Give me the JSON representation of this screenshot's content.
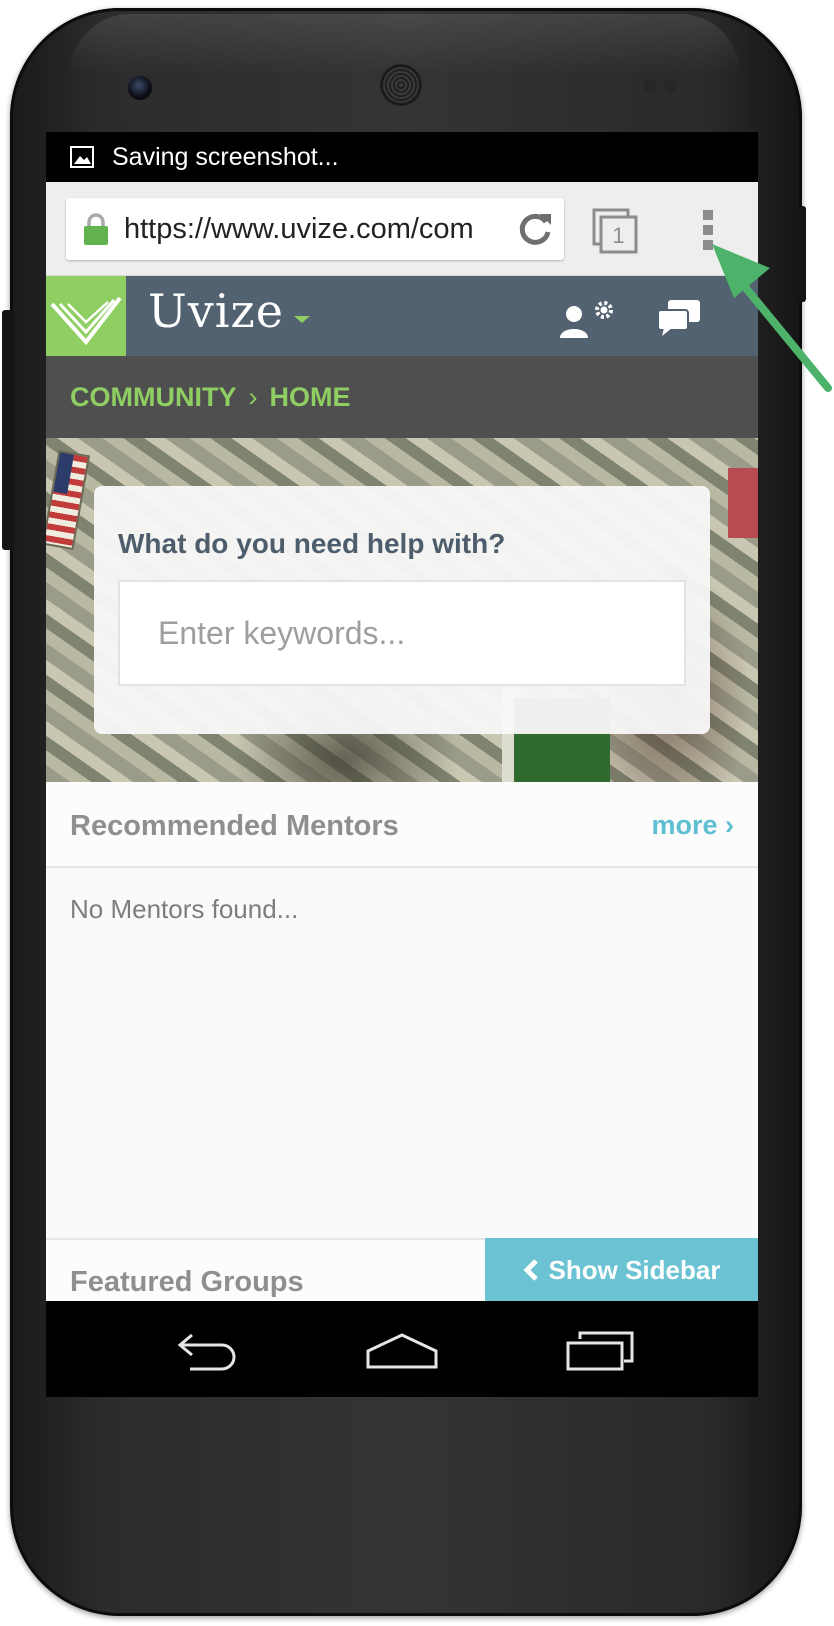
{
  "status_bar": {
    "notification_text": "Saving screenshot..."
  },
  "browser": {
    "url": "https://www.uvize.com/com",
    "tab_count": "1"
  },
  "site_header": {
    "brand_name": "Uvize"
  },
  "breadcrumb": {
    "items": [
      "COMMUNITY",
      "HOME"
    ],
    "separator": "›"
  },
  "hero_search": {
    "question": "What do you need help with?",
    "placeholder": "Enter keywords..."
  },
  "mentors_section": {
    "title": "Recommended Mentors",
    "more_label": "more ›",
    "empty_message": "No Mentors found..."
  },
  "groups_section": {
    "title": "Featured Groups"
  },
  "sidebar_toggle": {
    "label": "Show Sidebar"
  },
  "colors": {
    "brand_green": "#8fce62",
    "header_slate": "#536270",
    "breadcrumb_bg": "#4f4f4f",
    "accent_cyan": "#6bc2d3",
    "annotation_arrow": "#4db36a"
  },
  "icons": {
    "status": "image-icon",
    "lock": "lock-icon",
    "reload": "reload-icon",
    "tabs": "tabs-icon",
    "menu": "overflow-menu-icon",
    "profile": "profile-settings-icon",
    "messages": "chat-icon",
    "sidebar_chevron": "chevron-left-icon",
    "nav_back": "back-icon",
    "nav_home": "home-icon",
    "nav_recents": "recent-apps-icon"
  }
}
